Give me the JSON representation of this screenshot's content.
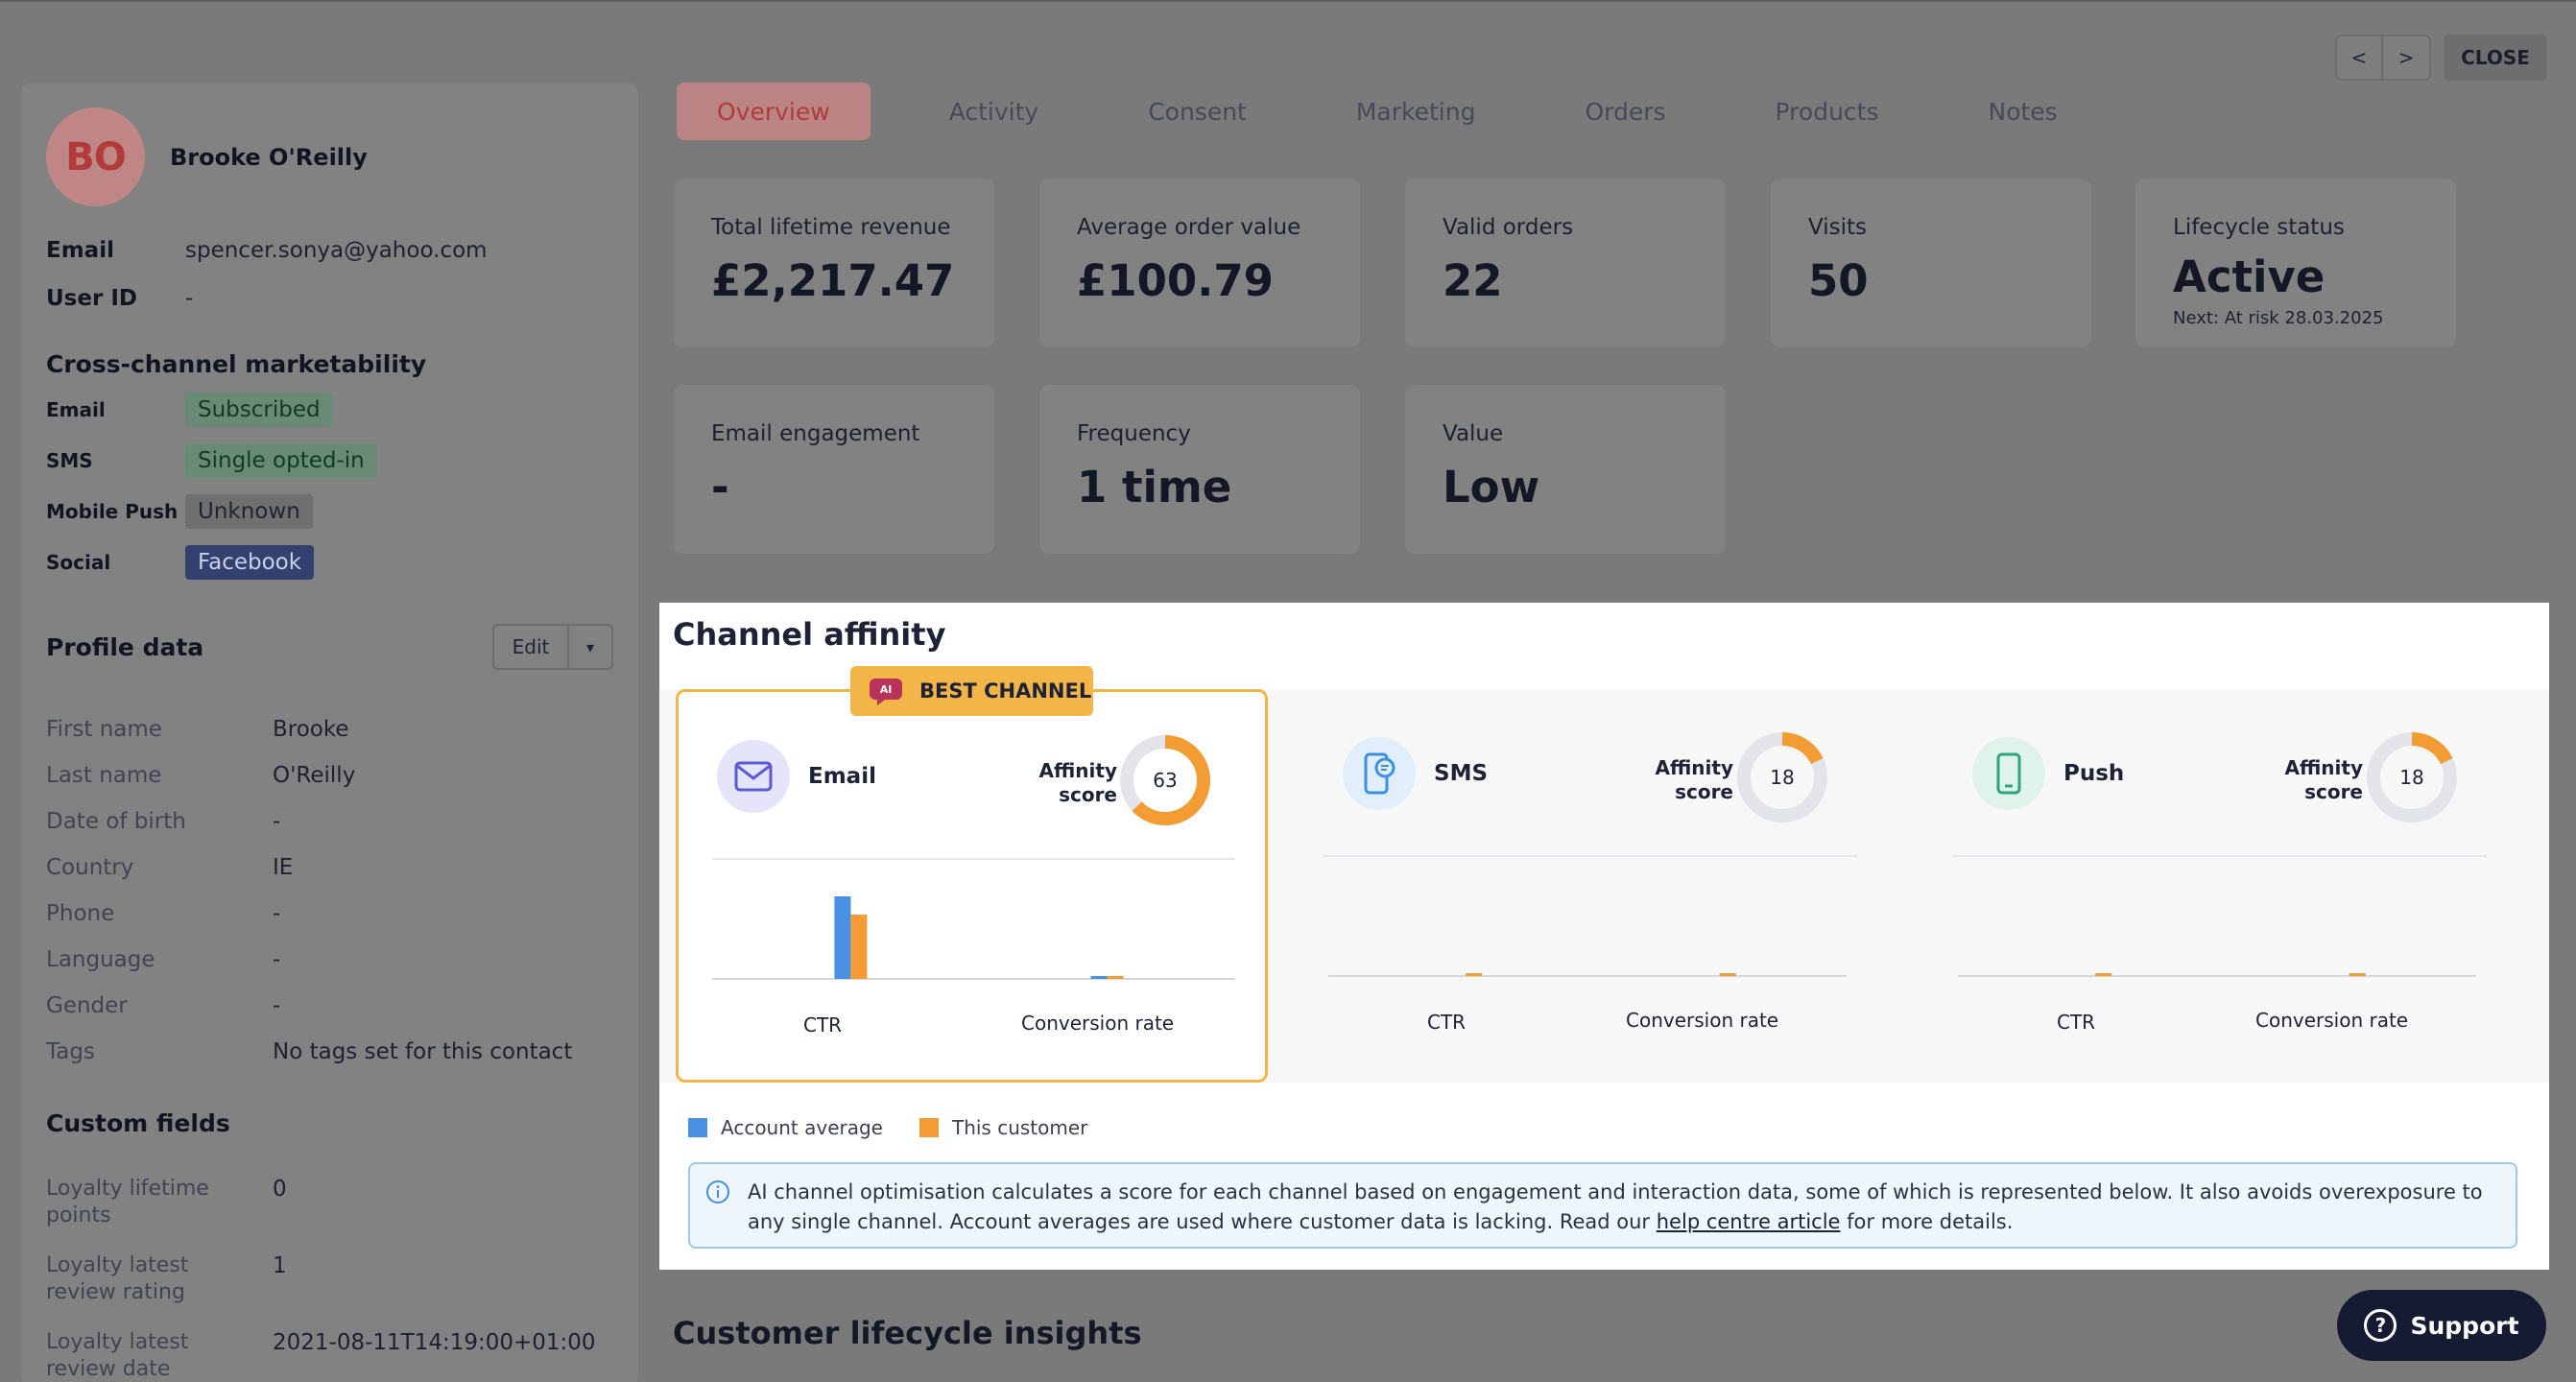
{
  "header": {
    "prev_label": "<",
    "next_label": ">",
    "close_label": "CLOSE"
  },
  "tabs": [
    {
      "label": "Overview",
      "active": true
    },
    {
      "label": "Activity"
    },
    {
      "label": "Consent"
    },
    {
      "label": "Marketing"
    },
    {
      "label": "Orders"
    },
    {
      "label": "Products"
    },
    {
      "label": "Notes"
    }
  ],
  "profile": {
    "initials": "BO",
    "name": "Brooke O'Reilly",
    "email_label": "Email",
    "email": "spencer.sonya@yahoo.com",
    "userid_label": "User ID",
    "userid": "-"
  },
  "marketability": {
    "title": "Cross-channel marketability",
    "rows": [
      {
        "channel": "Email",
        "status": "Subscribed"
      },
      {
        "channel": "SMS",
        "status": "Single opted-in"
      },
      {
        "channel": "Mobile Push",
        "status": "Unknown"
      },
      {
        "channel": "Social",
        "status": "Facebook"
      }
    ]
  },
  "profile_data": {
    "title": "Profile data",
    "edit_label": "Edit",
    "rows": [
      {
        "label": "First name",
        "value": "Brooke"
      },
      {
        "label": "Last name",
        "value": "O'Reilly"
      },
      {
        "label": "Date of birth",
        "value": "-"
      },
      {
        "label": "Country",
        "value": "IE"
      },
      {
        "label": "Phone",
        "value": "-"
      },
      {
        "label": "Language",
        "value": "-"
      },
      {
        "label": "Gender",
        "value": "-"
      },
      {
        "label": "Tags",
        "value": "No tags set for this contact"
      }
    ]
  },
  "custom_fields": {
    "title": "Custom fields",
    "rows": [
      {
        "label": "Loyalty lifetime points",
        "value": "0"
      },
      {
        "label": "Loyalty latest review rating",
        "value": "1"
      },
      {
        "label": "Loyalty latest review date",
        "value": "2021-08-11T14:19:00+01:00"
      }
    ]
  },
  "stats": [
    {
      "label": "Total lifetime revenue",
      "value": "£2,217.47"
    },
    {
      "label": "Average order value",
      "value": "£100.79"
    },
    {
      "label": "Valid orders",
      "value": "22"
    },
    {
      "label": "Visits",
      "value": "50"
    },
    {
      "label": "Lifecycle status",
      "value": "Active",
      "sub": "Next: At risk 28.03.2025"
    },
    {
      "label": "Email engagement",
      "value": "-"
    },
    {
      "label": "Frequency",
      "value": "1 time"
    },
    {
      "label": "Value",
      "value": "Low"
    }
  ],
  "affinity": {
    "title": "Channel affinity",
    "best_tag": "BEST CHANNEL",
    "ai_badge": "AI",
    "score_label_1": "Affinity",
    "score_label_2": "score",
    "channels": [
      {
        "name": "Email",
        "score": 63,
        "icon": "envelope-icon"
      },
      {
        "name": "SMS",
        "score": 18,
        "icon": "sms-phone-icon"
      },
      {
        "name": "Push",
        "score": 18,
        "icon": "mobile-icon"
      }
    ],
    "ctr_label": "CTR",
    "conv_label": "Conversion rate",
    "legend": [
      "Account average",
      "This customer"
    ],
    "info_text_1": "AI channel optimisation calculates a score for each channel based on engagement and interaction data, some of which is represented below. It also avoids overexposure to any single channel. Account averages are used where customer data is lacking. Read our ",
    "info_link": "help centre article",
    "info_text_2": " for more details."
  },
  "chart_data": [
    {
      "type": "bar",
      "title": "Email",
      "categories": [
        "CTR",
        "Conversion rate"
      ],
      "series": [
        {
          "name": "Account average",
          "values": [
            1.0,
            0.02
          ]
        },
        {
          "name": "This customer",
          "values": [
            0.78,
            0.02
          ]
        }
      ]
    },
    {
      "type": "bar",
      "title": "SMS",
      "categories": [
        "CTR",
        "Conversion rate"
      ],
      "series": [
        {
          "name": "Account average",
          "values": [
            0,
            0
          ]
        },
        {
          "name": "This customer",
          "values": [
            0.01,
            0.01
          ]
        }
      ]
    },
    {
      "type": "bar",
      "title": "Push",
      "categories": [
        "CTR",
        "Conversion rate"
      ],
      "series": [
        {
          "name": "Account average",
          "values": [
            0,
            0
          ]
        },
        {
          "name": "This customer",
          "values": [
            0.01,
            0.01
          ]
        }
      ]
    }
  ],
  "colors": {
    "account_average": "#4a90e2",
    "this_customer": "#f39c33",
    "best_channel": "#f3b548",
    "brand_red": "#b23a3a"
  },
  "lifecycle_title": "Customer lifecycle insights",
  "support_label": "Support"
}
